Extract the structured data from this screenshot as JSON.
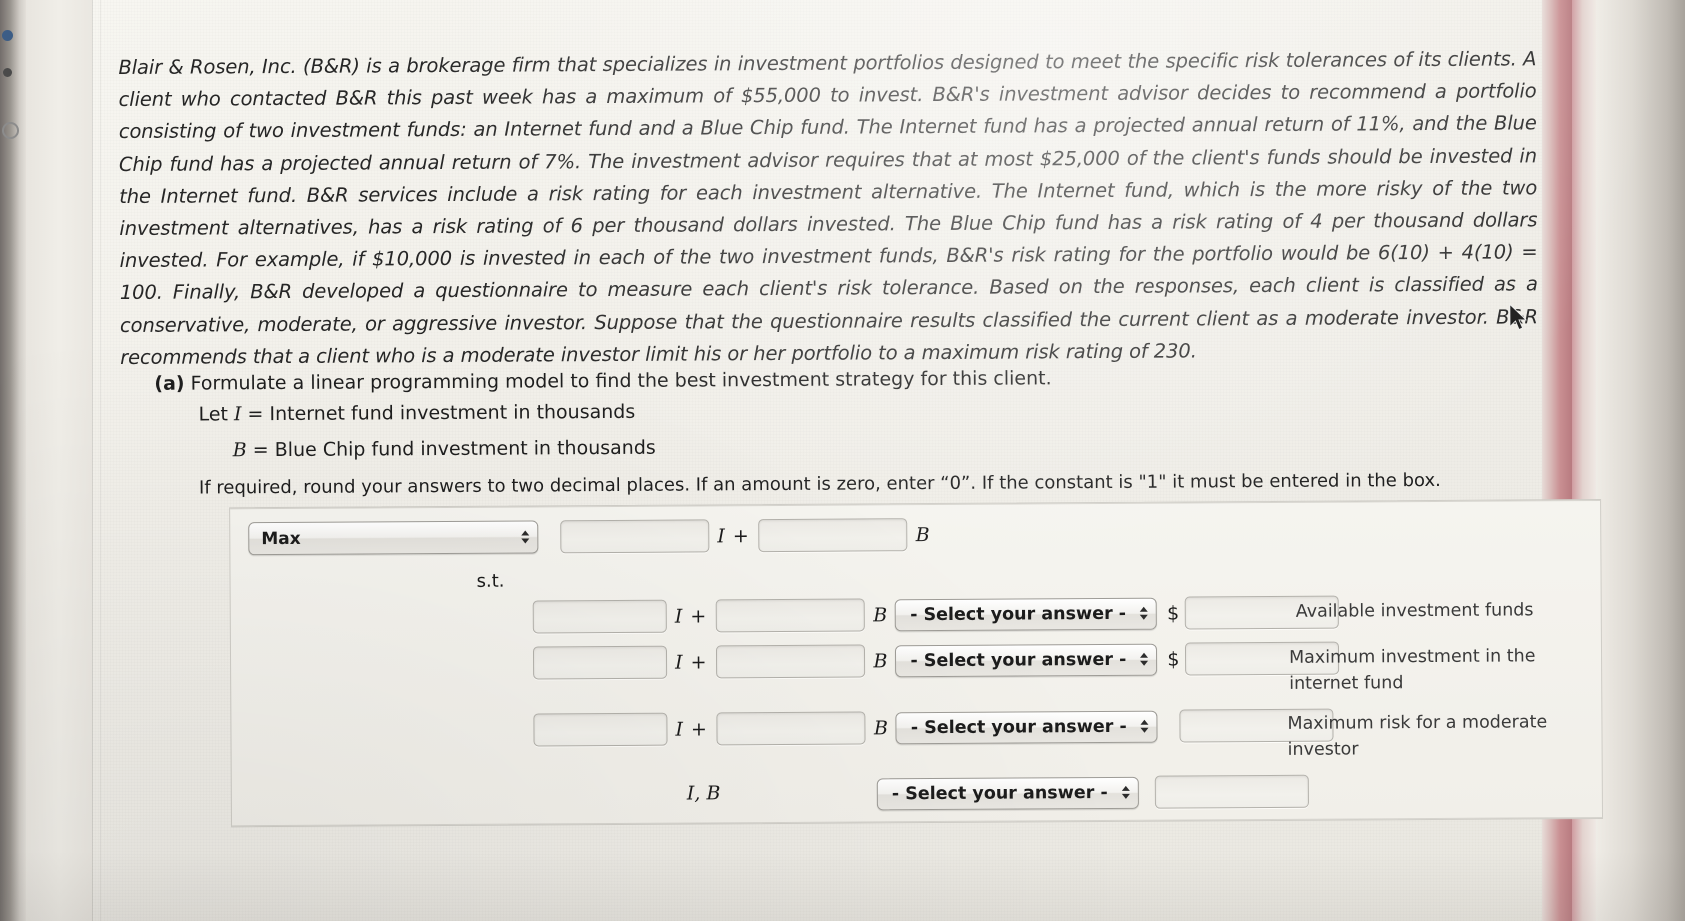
{
  "problem": {
    "text": "Blair & Rosen, Inc. (B&R) is a brokerage firm that specializes in investment portfolios designed to meet the specific risk tolerances of its clients. A client who contacted B&R this past week has a maximum of $55,000 to invest. B&R's investment advisor decides to recommend a portfolio consisting of two investment funds: an Internet fund and a Blue Chip fund. The Internet fund has a projected annual return of 11%, and the Blue Chip fund has a projected annual return of 7%. The investment advisor requires that at most $25,000 of the client's funds should be invested in the Internet fund. B&R services include a risk rating for each investment alternative. The Internet fund, which is the more risky of the two investment alternatives, has a risk rating of 6 per thousand dollars invested. The Blue Chip fund has a risk rating of 4 per thousand dollars invested. For example, if $10,000 is invested in each of the two investment funds, B&R's risk rating for the portfolio would be 6(10) + 4(10) = 100. Finally, B&R developed a questionnaire to measure each client's risk tolerance. Based on the responses, each client is classified as a conservative, moderate, or aggressive investor. Suppose that the questionnaire results classified the current client as a moderate investor. B&R recommends that a client who is a moderate investor limit his or her portfolio to a maximum risk rating of 230."
  },
  "part_a": {
    "marker": "(a)",
    "prompt": "Formulate a linear programming model to find the best investment strategy for this client.",
    "definition_1_prefix": "Let ",
    "definition_1_var": "I",
    "definition_1_text": " = Internet fund investment in thousands",
    "definition_2_var": "B",
    "definition_2_text": " = Blue Chip fund investment in thousands",
    "rounding_note": "If required, round your answers to two decimal places. If an amount is zero, enter “0”. If the constant is \"1\" it must be entered in the box."
  },
  "form": {
    "objective": {
      "direction_select_value": "Max",
      "coef_i_value": "",
      "coef_i_placeholder": "",
      "var_i": "I",
      "plus": "+",
      "coef_b_value": "",
      "coef_b_placeholder": "",
      "var_b": "B"
    },
    "subject_to_label": "s.t.",
    "select_placeholder": "- Select your answer -",
    "dollar_sign": "$",
    "constraints": [
      {
        "coef_i_value": "",
        "var_i": "I",
        "plus": "+",
        "coef_b_value": "",
        "var_b": "B",
        "relation_select_value": "- Select your answer -",
        "has_dollar": true,
        "rhs_value": "",
        "label": "Available investment funds"
      },
      {
        "coef_i_value": "",
        "var_i": "I",
        "plus": "+",
        "coef_b_value": "",
        "var_b": "B",
        "relation_select_value": "- Select your answer -",
        "has_dollar": true,
        "rhs_value": "",
        "label": "Maximum investment in the internet fund"
      },
      {
        "coef_i_value": "",
        "var_i": "I",
        "plus": "+",
        "coef_b_value": "",
        "var_b": "B",
        "relation_select_value": "- Select your answer -",
        "has_dollar": false,
        "rhs_value": "",
        "label": "Maximum risk for a moderate investor"
      }
    ],
    "nonnegativity": {
      "vars": "I, B",
      "relation_select_value": "- Select your answer -",
      "rhs_value": ""
    }
  },
  "icons": {
    "stepper": "up-down-arrows-icon",
    "cursor": "mouse-pointer-icon"
  }
}
